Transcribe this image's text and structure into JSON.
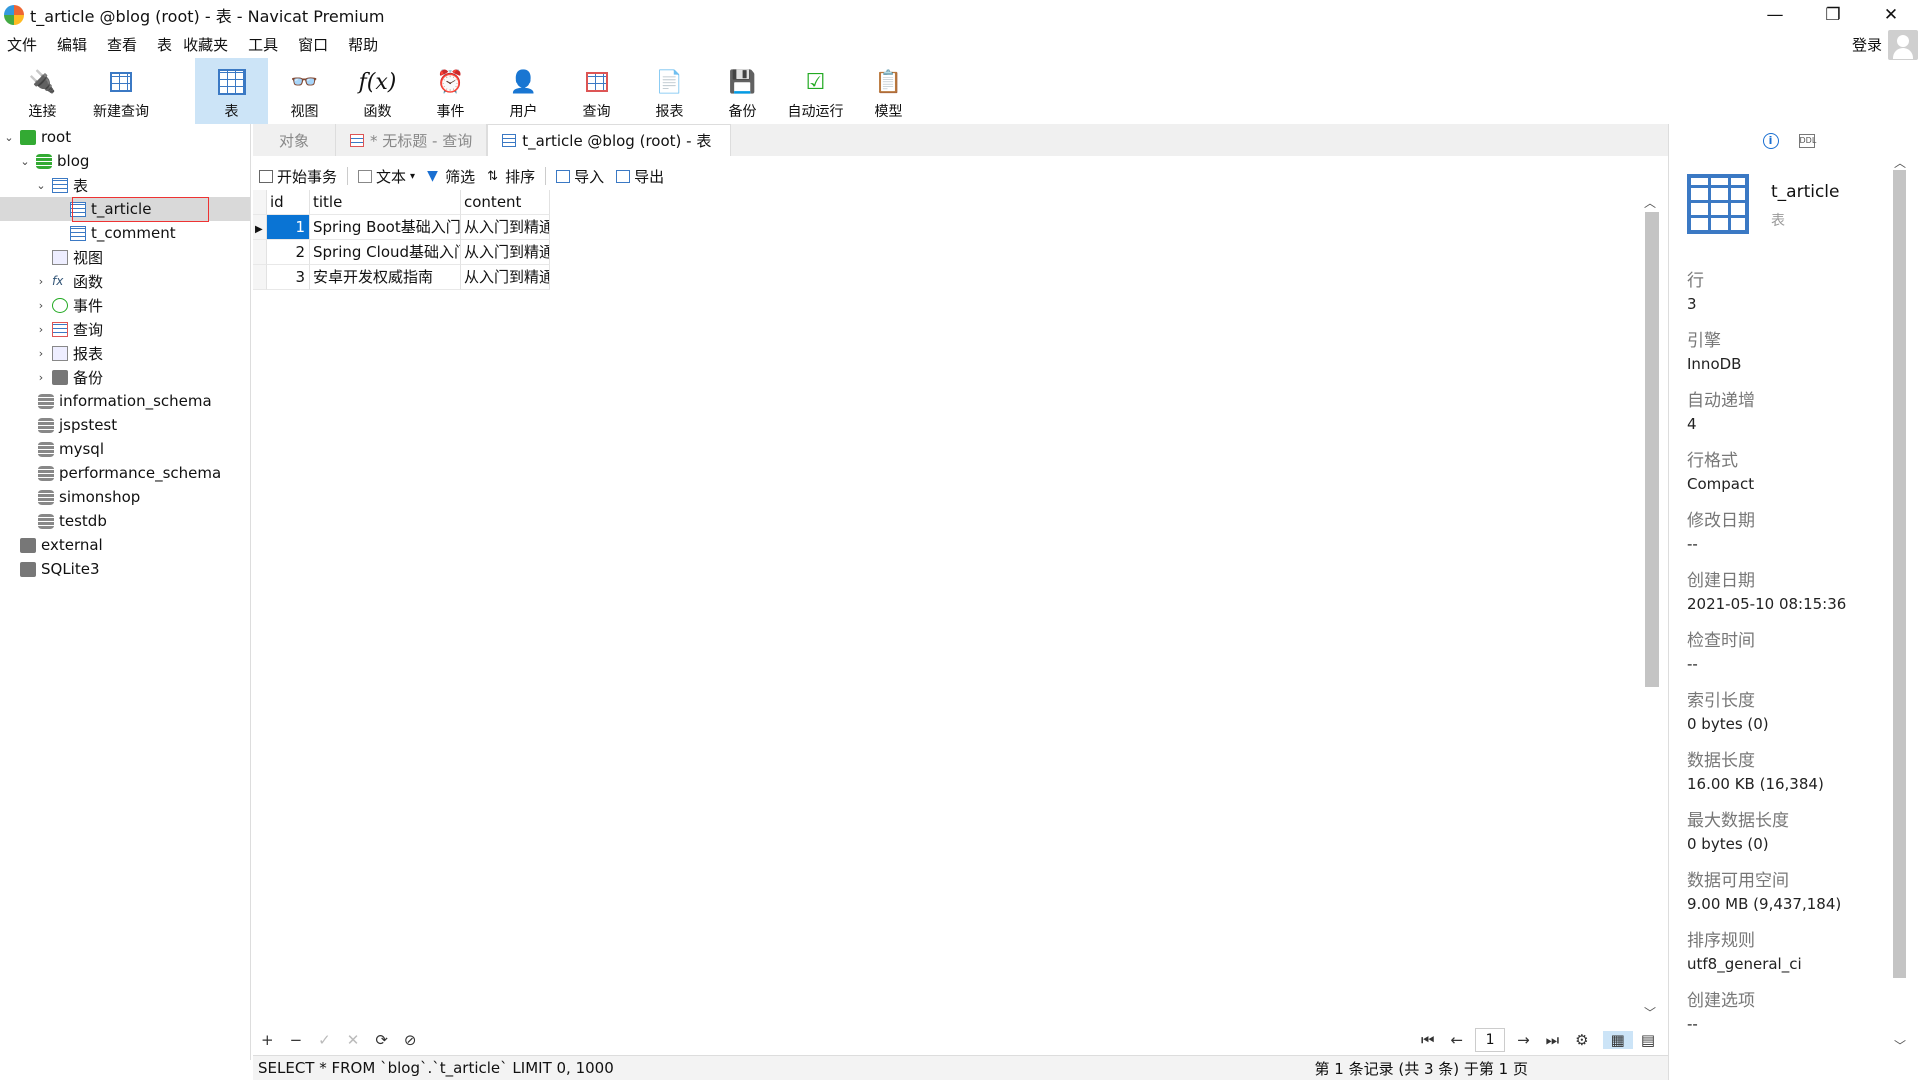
{
  "window": {
    "title": "t_article @blog (root) - 表 - Navicat Premium",
    "minimize": "—",
    "restore": "❐",
    "close": "✕"
  },
  "menu": {
    "items": [
      "文件",
      "编辑",
      "查看",
      "表",
      "收藏夹",
      "工具",
      "窗口",
      "帮助"
    ],
    "login": "登录"
  },
  "toolbar": {
    "items": [
      {
        "label": "连接",
        "icon": "connect-icon"
      },
      {
        "label": "新建查询",
        "icon": "new-query-icon"
      },
      {
        "label": "表",
        "icon": "table-icon",
        "active": true
      },
      {
        "label": "视图",
        "icon": "view-icon"
      },
      {
        "label": "函数",
        "icon": "function-icon"
      },
      {
        "label": "事件",
        "icon": "event-icon"
      },
      {
        "label": "用户",
        "icon": "user-icon"
      },
      {
        "label": "查询",
        "icon": "query-icon"
      },
      {
        "label": "报表",
        "icon": "report-icon"
      },
      {
        "label": "备份",
        "icon": "backup-icon"
      },
      {
        "label": "自动运行",
        "icon": "automation-icon"
      },
      {
        "label": "模型",
        "icon": "model-icon"
      }
    ]
  },
  "tree": {
    "root": "root",
    "blog": "blog",
    "tables": "表",
    "t_article": "t_article",
    "t_comment": "t_comment",
    "views": "视图",
    "functions": "函数",
    "events": "事件",
    "queries": "查询",
    "reports": "报表",
    "backups": "备份",
    "dbs": [
      "information_schema",
      "jspstest",
      "mysql",
      "performance_schema",
      "simonshop",
      "testdb"
    ],
    "external": "external",
    "sqlite": "SQLite3"
  },
  "tabs": {
    "objects": "对象",
    "untitled": "* 无标题 - 查询",
    "active": "t_article @blog (root) - 表"
  },
  "data_toolbar": {
    "begin_tx": "开始事务",
    "text": "文本",
    "filter": "筛选",
    "sort": "排序",
    "import": "导入",
    "export": "导出"
  },
  "grid": {
    "columns": [
      "id",
      "title",
      "content"
    ],
    "rows": [
      {
        "id": "1",
        "title": "Spring Boot基础入门",
        "content": "从入门到精通"
      },
      {
        "id": "2",
        "title": "Spring Cloud基础入门",
        "content": "从入门到精通"
      },
      {
        "id": "3",
        "title": "安卓开发权威指南",
        "content": "从入门到精通"
      }
    ]
  },
  "bottom": {
    "add": "+",
    "remove": "−",
    "apply": "✓",
    "cancel": "✕",
    "refresh": "⟳",
    "stop": "⊘",
    "first": "⏮",
    "prev": "←",
    "page": "1",
    "next": "→",
    "last": "⏭",
    "settings": "⚙"
  },
  "status": {
    "sql": "SELECT * FROM `blog`.`t_article` LIMIT 0, 1000",
    "records": "第 1 条记录 (共 3 条) 于第 1 页"
  },
  "info": {
    "name": "t_article",
    "type": "表",
    "props": [
      {
        "label": "行",
        "value": "3"
      },
      {
        "label": "引擎",
        "value": "InnoDB"
      },
      {
        "label": "自动递增",
        "value": "4"
      },
      {
        "label": "行格式",
        "value": "Compact"
      },
      {
        "label": "修改日期",
        "value": "--"
      },
      {
        "label": "创建日期",
        "value": "2021-05-10 08:15:36"
      },
      {
        "label": "检查时间",
        "value": "--"
      },
      {
        "label": "索引长度",
        "value": "0 bytes (0)"
      },
      {
        "label": "数据长度",
        "value": "16.00 KB (16,384)"
      },
      {
        "label": "最大数据长度",
        "value": "0 bytes (0)"
      },
      {
        "label": "数据可用空间",
        "value": "9.00 MB (9,437,184)"
      },
      {
        "label": "排序规则",
        "value": "utf8_general_ci"
      },
      {
        "label": "创建选项",
        "value": "--"
      }
    ]
  }
}
